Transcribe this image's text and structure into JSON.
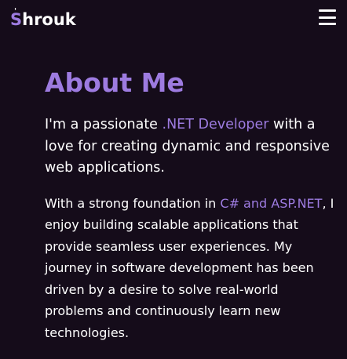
{
  "nav": {
    "logo_initial": "S",
    "logo_mark": "'",
    "logo_rest": "hrouk",
    "menu_icon": "hamburger-menu-icon"
  },
  "about": {
    "title": "About Me",
    "intro_before": "I'm a passionate ",
    "intro_highlight": ".NET Developer",
    "intro_after": " with a love for creating dynamic and responsive web applications.",
    "body_before": "With a strong foundation in ",
    "body_highlight": "C# and ASP.NET",
    "body_after": ", I enjoy building scalable applications that provide seamless user experiences. My journey in software development has been driven by a desire to solve real-world problems and continuously learn new technologies."
  },
  "colors": {
    "background": "#150c1a",
    "accent": "#9d7be0",
    "text": "#ffffff"
  }
}
